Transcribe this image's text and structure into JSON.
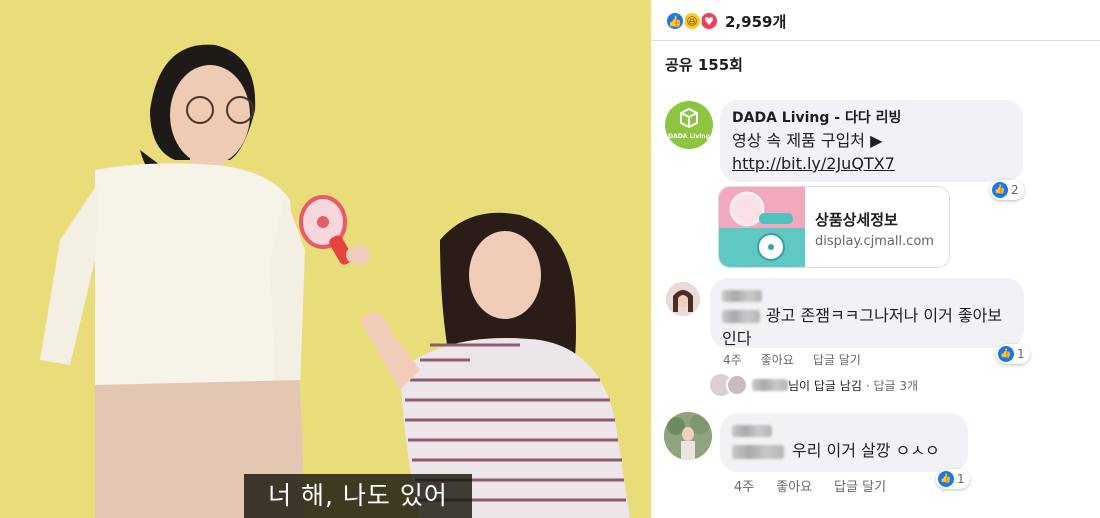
{
  "video": {
    "caption": "너 해, 나도 있어",
    "colors": {
      "backdrop": "#e9dd7a",
      "caption_bg": "#18160e"
    }
  },
  "post": {
    "reaction_icons": [
      "like-icon",
      "haha-icon",
      "love-icon"
    ],
    "reaction_count": "2,959개",
    "shares": "공유 155회"
  },
  "comments": [
    {
      "author": "DADA Living - 다다 리빙",
      "avatar_text": "DADA Living",
      "text": "영상 속 제품 구입처 ▶ ",
      "link": "http://bit.ly/2JuQTX7",
      "likes": "2",
      "preview": {
        "title": "상품상세정보",
        "domain": "display.cjmall.com"
      }
    },
    {
      "text": "광고 존잼ㅋㅋ그나저나 이거 좋아보인다",
      "time": "4주",
      "like_action": "좋아요",
      "reply_action": "답글 달기",
      "likes": "1",
      "replies_summary": "님이 답글 남김",
      "replies_count": "· 답글 3개"
    },
    {
      "text": "우리 이거 살깡 ㅇㅅㅇ",
      "time": "4주",
      "like_action": "좋아요",
      "reply_action": "답글 달기",
      "likes": "1"
    }
  ],
  "colors": {
    "accent": "#1877f2",
    "bubble": "#f0f2f5",
    "meta": "#65676b",
    "brand_green": "#8cc63f"
  }
}
